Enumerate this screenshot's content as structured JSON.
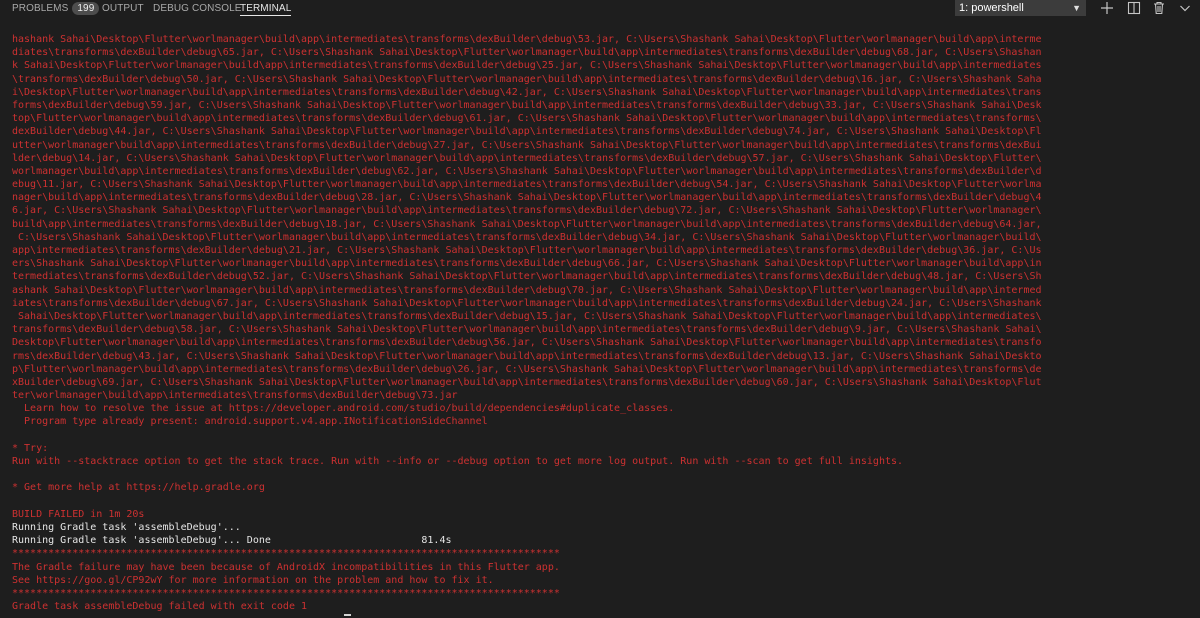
{
  "panel": {
    "tabs": [
      {
        "label": "PROBLEMS",
        "badge": "199"
      },
      {
        "label": "OUTPUT"
      },
      {
        "label": "DEBUG CONSOLE"
      },
      {
        "label": "TERMINAL"
      }
    ],
    "terminal_select": {
      "value": "1: powershell"
    },
    "actions": [
      "add-icon",
      "split-icon",
      "trash-icon",
      "chevron-down-icon"
    ]
  },
  "terminal": {
    "lines": [
      {
        "text": "hashank Sahai\\Desktop\\Flutter\\worlmanager\\build\\app\\intermediates\\transforms\\dexBuilder\\debug\\53.jar, C:\\Users\\Shashank Sahai\\Desktop\\Flutter\\worlmanager\\build\\app\\interme",
        "color": "red"
      },
      {
        "text": "diates\\transforms\\dexBuilder\\debug\\65.jar, C:\\Users\\Shashank Sahai\\Desktop\\Flutter\\worlmanager\\build\\app\\intermediates\\transforms\\dexBuilder\\debug\\68.jar, C:\\Users\\Shashan",
        "color": "red"
      },
      {
        "text": "k Sahai\\Desktop\\Flutter\\worlmanager\\build\\app\\intermediates\\transforms\\dexBuilder\\debug\\25.jar, C:\\Users\\Shashank Sahai\\Desktop\\Flutter\\worlmanager\\build\\app\\intermediates",
        "color": "red"
      },
      {
        "text": "\\transforms\\dexBuilder\\debug\\50.jar, C:\\Users\\Shashank Sahai\\Desktop\\Flutter\\worlmanager\\build\\app\\intermediates\\transforms\\dexBuilder\\debug\\16.jar, C:\\Users\\Shashank Saha",
        "color": "red"
      },
      {
        "text": "i\\Desktop\\Flutter\\worlmanager\\build\\app\\intermediates\\transforms\\dexBuilder\\debug\\42.jar, C:\\Users\\Shashank Sahai\\Desktop\\Flutter\\worlmanager\\build\\app\\intermediates\\trans",
        "color": "red"
      },
      {
        "text": "forms\\dexBuilder\\debug\\59.jar, C:\\Users\\Shashank Sahai\\Desktop\\Flutter\\worlmanager\\build\\app\\intermediates\\transforms\\dexBuilder\\debug\\33.jar, C:\\Users\\Shashank Sahai\\Desk",
        "color": "red"
      },
      {
        "text": "top\\Flutter\\worlmanager\\build\\app\\intermediates\\transforms\\dexBuilder\\debug\\61.jar, C:\\Users\\Shashank Sahai\\Desktop\\Flutter\\worlmanager\\build\\app\\intermediates\\transforms\\",
        "color": "red"
      },
      {
        "text": "dexBuilder\\debug\\44.jar, C:\\Users\\Shashank Sahai\\Desktop\\Flutter\\worlmanager\\build\\app\\intermediates\\transforms\\dexBuilder\\debug\\74.jar, C:\\Users\\Shashank Sahai\\Desktop\\Fl",
        "color": "red"
      },
      {
        "text": "utter\\worlmanager\\build\\app\\intermediates\\transforms\\dexBuilder\\debug\\27.jar, C:\\Users\\Shashank Sahai\\Desktop\\Flutter\\worlmanager\\build\\app\\intermediates\\transforms\\dexBui",
        "color": "red"
      },
      {
        "text": "lder\\debug\\14.jar, C:\\Users\\Shashank Sahai\\Desktop\\Flutter\\worlmanager\\build\\app\\intermediates\\transforms\\dexBuilder\\debug\\57.jar, C:\\Users\\Shashank Sahai\\Desktop\\Flutter\\",
        "color": "red"
      },
      {
        "text": "worlmanager\\build\\app\\intermediates\\transforms\\dexBuilder\\debug\\62.jar, C:\\Users\\Shashank Sahai\\Desktop\\Flutter\\worlmanager\\build\\app\\intermediates\\transforms\\dexBuilder\\d",
        "color": "red"
      },
      {
        "text": "ebug\\11.jar, C:\\Users\\Shashank Sahai\\Desktop\\Flutter\\worlmanager\\build\\app\\intermediates\\transforms\\dexBuilder\\debug\\54.jar, C:\\Users\\Shashank Sahai\\Desktop\\Flutter\\worlma",
        "color": "red"
      },
      {
        "text": "nager\\build\\app\\intermediates\\transforms\\dexBuilder\\debug\\28.jar, C:\\Users\\Shashank Sahai\\Desktop\\Flutter\\worlmanager\\build\\app\\intermediates\\transforms\\dexBuilder\\debug\\4",
        "color": "red"
      },
      {
        "text": "6.jar, C:\\Users\\Shashank Sahai\\Desktop\\Flutter\\worlmanager\\build\\app\\intermediates\\transforms\\dexBuilder\\debug\\72.jar, C:\\Users\\Shashank Sahai\\Desktop\\Flutter\\worlmanager\\",
        "color": "red"
      },
      {
        "text": "build\\app\\intermediates\\transforms\\dexBuilder\\debug\\18.jar, C:\\Users\\Shashank Sahai\\Desktop\\Flutter\\worlmanager\\build\\app\\intermediates\\transforms\\dexBuilder\\debug\\64.jar,",
        "color": "red"
      },
      {
        "text": " C:\\Users\\Shashank Sahai\\Desktop\\Flutter\\worlmanager\\build\\app\\intermediates\\transforms\\dexBuilder\\debug\\34.jar, C:\\Users\\Shashank Sahai\\Desktop\\Flutter\\worlmanager\\build\\",
        "color": "red"
      },
      {
        "text": "app\\intermediates\\transforms\\dexBuilder\\debug\\21.jar, C:\\Users\\Shashank Sahai\\Desktop\\Flutter\\worlmanager\\build\\app\\intermediates\\transforms\\dexBuilder\\debug\\36.jar, C:\\Us",
        "color": "red"
      },
      {
        "text": "ers\\Shashank Sahai\\Desktop\\Flutter\\worlmanager\\build\\app\\intermediates\\transforms\\dexBuilder\\debug\\66.jar, C:\\Users\\Shashank Sahai\\Desktop\\Flutter\\worlmanager\\build\\app\\in",
        "color": "red"
      },
      {
        "text": "termediates\\transforms\\dexBuilder\\debug\\52.jar, C:\\Users\\Shashank Sahai\\Desktop\\Flutter\\worlmanager\\build\\app\\intermediates\\transforms\\dexBuilder\\debug\\48.jar, C:\\Users\\Sh",
        "color": "red"
      },
      {
        "text": "ashank Sahai\\Desktop\\Flutter\\worlmanager\\build\\app\\intermediates\\transforms\\dexBuilder\\debug\\70.jar, C:\\Users\\Shashank Sahai\\Desktop\\Flutter\\worlmanager\\build\\app\\intermed",
        "color": "red"
      },
      {
        "text": "iates\\transforms\\dexBuilder\\debug\\67.jar, C:\\Users\\Shashank Sahai\\Desktop\\Flutter\\worlmanager\\build\\app\\intermediates\\transforms\\dexBuilder\\debug\\24.jar, C:\\Users\\Shashank",
        "color": "red"
      },
      {
        "text": " Sahai\\Desktop\\Flutter\\worlmanager\\build\\app\\intermediates\\transforms\\dexBuilder\\debug\\15.jar, C:\\Users\\Shashank Sahai\\Desktop\\Flutter\\worlmanager\\build\\app\\intermediates\\",
        "color": "red"
      },
      {
        "text": "transforms\\dexBuilder\\debug\\58.jar, C:\\Users\\Shashank Sahai\\Desktop\\Flutter\\worlmanager\\build\\app\\intermediates\\transforms\\dexBuilder\\debug\\9.jar, C:\\Users\\Shashank Sahai\\",
        "color": "red"
      },
      {
        "text": "Desktop\\Flutter\\worlmanager\\build\\app\\intermediates\\transforms\\dexBuilder\\debug\\56.jar, C:\\Users\\Shashank Sahai\\Desktop\\Flutter\\worlmanager\\build\\app\\intermediates\\transfo",
        "color": "red"
      },
      {
        "text": "rms\\dexBuilder\\debug\\43.jar, C:\\Users\\Shashank Sahai\\Desktop\\Flutter\\worlmanager\\build\\app\\intermediates\\transforms\\dexBuilder\\debug\\13.jar, C:\\Users\\Shashank Sahai\\Deskto",
        "color": "red"
      },
      {
        "text": "p\\Flutter\\worlmanager\\build\\app\\intermediates\\transforms\\dexBuilder\\debug\\26.jar, C:\\Users\\Shashank Sahai\\Desktop\\Flutter\\worlmanager\\build\\app\\intermediates\\transforms\\de",
        "color": "red"
      },
      {
        "text": "xBuilder\\debug\\69.jar, C:\\Users\\Shashank Sahai\\Desktop\\Flutter\\worlmanager\\build\\app\\intermediates\\transforms\\dexBuilder\\debug\\60.jar, C:\\Users\\Shashank Sahai\\Desktop\\Flut",
        "color": "red"
      },
      {
        "text": "ter\\worlmanager\\build\\app\\intermediates\\transforms\\dexBuilder\\debug\\73.jar",
        "color": "red"
      },
      {
        "text": "  Learn how to resolve the issue at https://developer.android.com/studio/build/dependencies#duplicate_classes.",
        "color": "red"
      },
      {
        "text": "  Program type already present: android.support.v4.app.INotificationSideChannel",
        "color": "red"
      },
      {
        "text": "",
        "color": "red"
      },
      {
        "text": "* Try:",
        "color": "red"
      },
      {
        "text": "Run with --stacktrace option to get the stack trace. Run with --info or --debug option to get more log output. Run with --scan to get full insights.",
        "color": "red"
      },
      {
        "text": "",
        "color": "red"
      },
      {
        "text": "* Get more help at https://help.gradle.org",
        "color": "red"
      },
      {
        "text": "",
        "color": "red"
      },
      {
        "text": "BUILD FAILED in 1m 20s",
        "color": "red"
      },
      {
        "text": "Running Gradle task 'assembleDebug'...",
        "color": "white"
      },
      {
        "text": "Running Gradle task 'assembleDebug'... Done                         81.4s",
        "color": "white"
      },
      {
        "text": "*******************************************************************************************",
        "color": "red"
      },
      {
        "text": "The Gradle failure may have been because of AndroidX incompatibilities in this Flutter app.",
        "color": "red"
      },
      {
        "text": "See https://goo.gl/CP92wY for more information on the problem and how to fix it.",
        "color": "red"
      },
      {
        "text": "*******************************************************************************************",
        "color": "red"
      },
      {
        "text": "Gradle task assembleDebug failed with exit code 1",
        "color": "red"
      }
    ]
  }
}
